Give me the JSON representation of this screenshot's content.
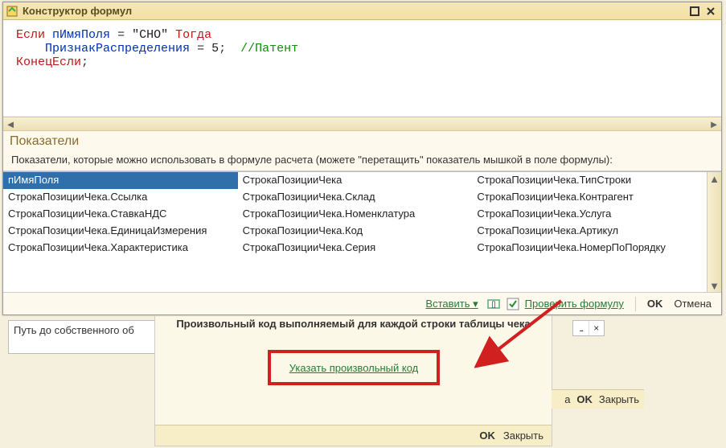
{
  "window": {
    "title": "Конструктор формул"
  },
  "code": {
    "line1_kw1": "Если",
    "line1_ident": "пИмяПоля",
    "line1_eq": "=",
    "line1_str": "\"СНО\"",
    "line1_kw2": "Тогда",
    "line2_ident": "ПризнакРаспределения",
    "line2_eq": "=",
    "line2_num": "5",
    "line2_semi": ";",
    "line2_comment": "//Патент",
    "line3_kw": "КонецЕсли",
    "line3_semi": ";"
  },
  "indicators": {
    "title": "Показатели",
    "desc": "Показатели, которые можно использовать в формуле расчета (можете \"перетащить\" показатель мышкой в поле формулы):",
    "items": [
      "пИмяПоля",
      "СтрокаПозицииЧека.Ссылка",
      "СтрокаПозицииЧека.СтавкаНДС",
      "СтрокаПозицииЧека.ЕдиницаИзмерения",
      "СтрокаПозицииЧека.Характеристика",
      "СтрокаПозицииЧека",
      "СтрокаПозицииЧека.Склад",
      "СтрокаПозицииЧека.Номенклатура",
      "СтрокаПозицииЧека.Код",
      "СтрокаПозицииЧека.Серия",
      "СтрокаПозицииЧека.ТипСтроки",
      "СтрокаПозицииЧека.Контрагент",
      "СтрокаПозицииЧека.Услуга",
      "СтрокаПозицииЧека.Артикул",
      "СтрокаПозицииЧека.НомерПоПорядку"
    ],
    "selected_index": 0
  },
  "footer": {
    "insert": "Вставить",
    "check": "Проверить формулу",
    "ok": "OK",
    "cancel": "Отмена"
  },
  "background": {
    "left_box_text": "Путь до собственного об",
    "mid_header": "Произвольный код выполняемый для каждой строки таблицы чека",
    "mid_link": "Указать произвольный код",
    "mid_ok": "OK",
    "mid_close": "Закрыть",
    "right_small_dots": "...",
    "right_small_x": "×",
    "bottom_a": "а",
    "bottom_ok": "OK",
    "bottom_close": "Закрыть"
  }
}
